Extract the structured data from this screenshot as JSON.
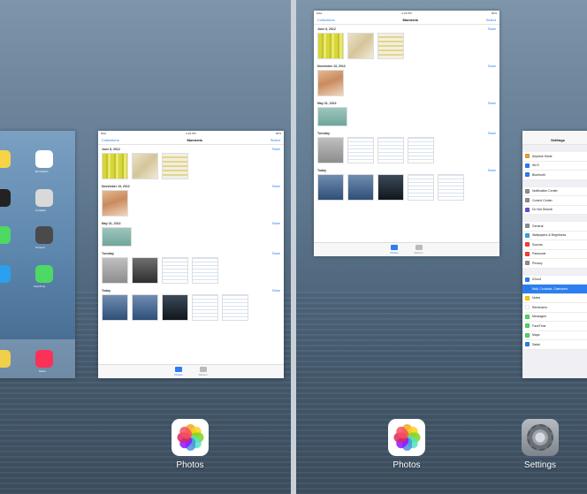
{
  "left_pane": {
    "photos_card": {
      "status_left": "iPad",
      "status_time": "2:26 PM",
      "status_right": "80%",
      "nav_back": "Collections",
      "nav_title": "Moments",
      "nav_select": "Select",
      "sections": [
        {
          "date": "June 6, 2012",
          "share": "Share"
        },
        {
          "date": "November 13, 2012",
          "share": "Share"
        },
        {
          "date": "May 31, 2013",
          "share": "Share"
        },
        {
          "date": "Tuesday",
          "share": "Share"
        },
        {
          "date": "Today",
          "share": "Share"
        }
      ],
      "tabs": [
        "Photos",
        "Albums"
      ]
    },
    "home_sliver": {
      "labels": [
        "Reminders",
        "Contacts",
        "Camera",
        "FaceTime",
        "Music"
      ]
    },
    "dock_app": {
      "label": "Photos",
      "icon": "photos-icon"
    }
  },
  "right_pane": {
    "photos_card": {
      "status_left": "iPad",
      "status_time": "2:26 PM",
      "status_right": "80%",
      "nav_back": "Collections",
      "nav_title": "Moments",
      "nav_select": "Select",
      "sections": [
        {
          "date": "June 6, 2012",
          "share": "Share"
        },
        {
          "date": "November 13, 2012",
          "share": "Share"
        },
        {
          "date": "May 31, 2013",
          "share": "Share"
        },
        {
          "date": "Tuesday",
          "share": "Share"
        },
        {
          "date": "Today",
          "share": "Share"
        }
      ],
      "tabs": [
        "Photos",
        "Albums"
      ]
    },
    "settings_card": {
      "title": "Settings",
      "rows": [
        {
          "label": "Airplane Mode",
          "color": "#f0a030"
        },
        {
          "label": "Wi-Fi",
          "color": "#2b7ff0"
        },
        {
          "label": "Bluetooth",
          "color": "#2b7ff0"
        },
        {
          "label": "Notification Center",
          "color": "#8e8e93"
        },
        {
          "label": "Control Center",
          "color": "#8e8e93"
        },
        {
          "label": "Do Not Disturb",
          "color": "#5856d6"
        },
        {
          "label": "General",
          "color": "#8e8e93"
        },
        {
          "label": "Wallpapers & Brightness",
          "color": "#34aadc"
        },
        {
          "label": "Sounds",
          "color": "#ff3b30"
        },
        {
          "label": "Passcode",
          "color": "#ff3b30"
        },
        {
          "label": "Privacy",
          "color": "#8e8e93"
        },
        {
          "label": "iCloud",
          "color": "#2b7ff0"
        },
        {
          "label": "Mail, Contacts, Calendars",
          "color": "#2b7ff0"
        },
        {
          "label": "Notes",
          "color": "#ffcc00"
        },
        {
          "label": "Reminders",
          "color": "#ffffff"
        },
        {
          "label": "Messages",
          "color": "#4cd964"
        },
        {
          "label": "FaceTime",
          "color": "#4cd964"
        },
        {
          "label": "Maps",
          "color": "#4cd964"
        },
        {
          "label": "Safari",
          "color": "#2b7ff0"
        }
      ],
      "highlighted_index": 12
    },
    "dock_apps": [
      {
        "label": "Photos",
        "icon": "photos-icon"
      },
      {
        "label": "Settings",
        "icon": "settings-icon"
      }
    ]
  }
}
